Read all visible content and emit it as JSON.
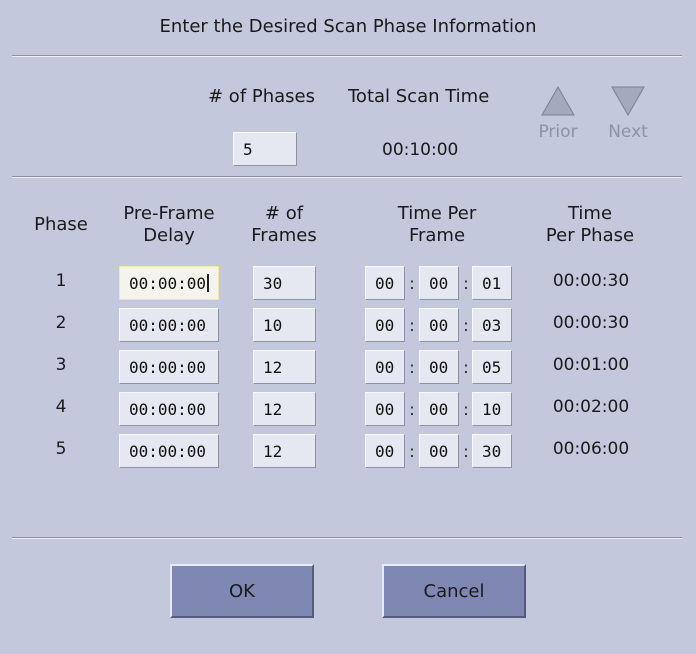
{
  "dialog": {
    "title": "Enter the Desired Scan Phase Information"
  },
  "summary": {
    "phases_label": "# of Phases",
    "phases_value": "5",
    "total_time_label": "Total Scan Time",
    "total_time_value": "00:10:00"
  },
  "nav": {
    "prior_label": "Prior",
    "next_label": "Next",
    "prior_icon": "triangle-up-icon",
    "next_icon": "triangle-down-icon"
  },
  "table": {
    "headers": {
      "phase": "Phase",
      "delay_l1": "Pre-Frame",
      "delay_l2": "Delay",
      "frames_l1": "# of",
      "frames_l2": "Frames",
      "tpf_l1": "Time Per",
      "tpf_l2": "Frame",
      "tpp_l1": "Time",
      "tpp_l2": "Per Phase"
    },
    "rows": [
      {
        "phase": "1",
        "delay": "00:00:00",
        "frames": "30",
        "h": "00",
        "m": "00",
        "s": "01",
        "tpp": "00:00:30"
      },
      {
        "phase": "2",
        "delay": "00:00:00",
        "frames": "10",
        "h": "00",
        "m": "00",
        "s": "03",
        "tpp": "00:00:30"
      },
      {
        "phase": "3",
        "delay": "00:00:00",
        "frames": "12",
        "h": "00",
        "m": "00",
        "s": "05",
        "tpp": "00:01:00"
      },
      {
        "phase": "4",
        "delay": "00:00:00",
        "frames": "12",
        "h": "00",
        "m": "00",
        "s": "10",
        "tpp": "00:02:00"
      },
      {
        "phase": "5",
        "delay": "00:00:00",
        "frames": "12",
        "h": "00",
        "m": "00",
        "s": "30",
        "tpp": "00:06:00"
      }
    ]
  },
  "buttons": {
    "ok_label": "OK",
    "cancel_label": "Cancel"
  },
  "colors": {
    "background": "#c3c8dc",
    "button": "#7f88b3",
    "field": "#e6e8f1",
    "disabled_text": "#8e92a6"
  }
}
